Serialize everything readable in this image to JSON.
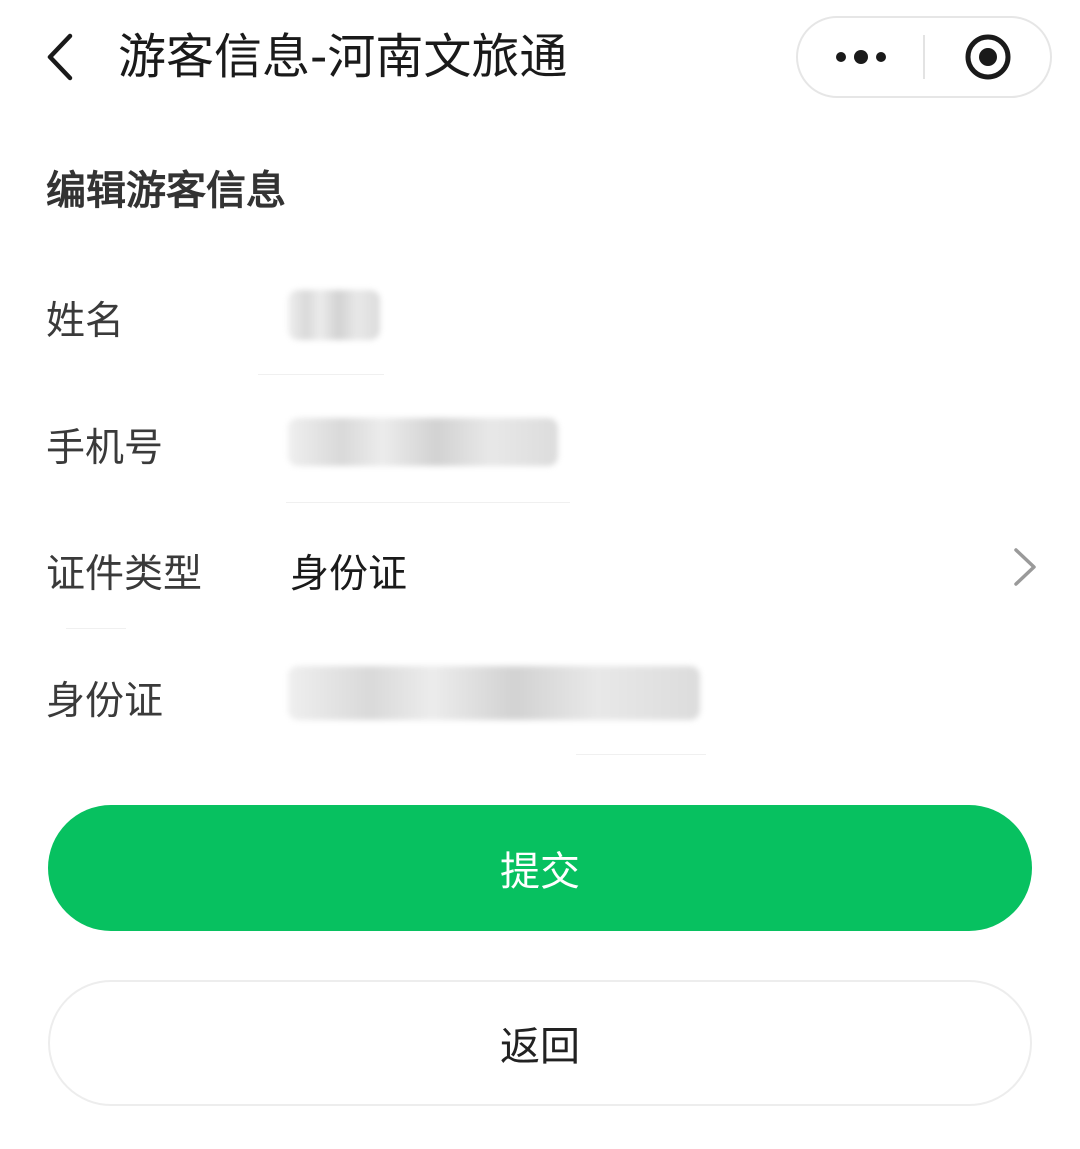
{
  "header": {
    "title": "游客信息-河南文旅通",
    "back_icon": "chevron-left-icon",
    "menu_icon": "more-dots-icon",
    "close_icon": "target-circle-icon"
  },
  "section": {
    "title": "编辑游客信息"
  },
  "form": {
    "name_label": "姓名",
    "phone_label": "手机号",
    "id_type_label": "证件类型",
    "id_type_value": "身份证",
    "id_number_label": "身份证"
  },
  "buttons": {
    "submit_label": "提交",
    "back_label": "返回"
  },
  "colors": {
    "accent": "#07c160",
    "text": "#222222",
    "label": "#3a3a3a"
  }
}
